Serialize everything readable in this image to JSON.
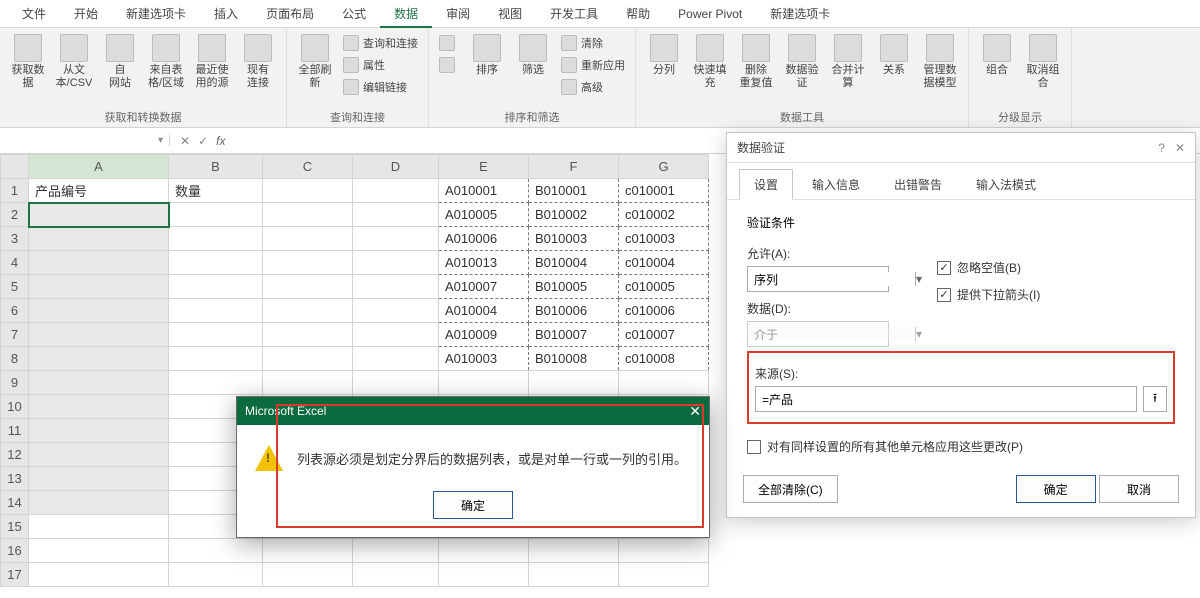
{
  "ribbon_tabs": [
    "文件",
    "开始",
    "新建选项卡",
    "插入",
    "页面布局",
    "公式",
    "数据",
    "审阅",
    "视图",
    "开发工具",
    "帮助",
    "Power Pivot",
    "新建选项卡"
  ],
  "active_tab_index": 6,
  "ribbon": {
    "g1": {
      "label": "获取和转换数据",
      "btns": [
        "获取数\n据",
        "从文\n本/CSV",
        "自\n网站",
        "来自表\n格/区域",
        "最近使\n用的源",
        "现有\n连接"
      ]
    },
    "g2": {
      "label": "查询和连接",
      "main": "全部刷\n新",
      "items": [
        "查询和连接",
        "属性",
        "编辑链接"
      ]
    },
    "g3": {
      "label": "排序和筛选",
      "sort_big": "排序",
      "filter_big": "筛选",
      "items": [
        "清除",
        "重新应用",
        "高级"
      ]
    },
    "g4": {
      "label": "数据工具",
      "btns": [
        "分列",
        "快速填充",
        "删除\n重复值",
        "数据验\n证",
        "合并计算",
        "关系",
        "管理数\n据模型"
      ]
    },
    "g5": {
      "label": "分级显示",
      "btns": [
        "组合",
        "取消组合"
      ]
    }
  },
  "name_box": "",
  "col_headers": [
    "A",
    "B",
    "C",
    "D",
    "E",
    "F",
    "G"
  ],
  "row_count": 17,
  "cells": {
    "A1": "产品编号",
    "B1": "数量",
    "E1": "A010001",
    "F1": "B010001",
    "G1": "c010001",
    "E2": "A010005",
    "F2": "B010002",
    "G2": "c010002",
    "E3": "A010006",
    "F3": "B010003",
    "G3": "c010003",
    "E4": "A010013",
    "F4": "B010004",
    "G4": "c010004",
    "E5": "A010007",
    "F5": "B010005",
    "G5": "c010005",
    "E6": "A010004",
    "F6": "B010006",
    "G6": "c010006",
    "E7": "A010009",
    "F7": "B010007",
    "G7": "c010007",
    "E8": "A010003",
    "F8": "B010008",
    "G8": "c010008"
  },
  "dv": {
    "title": "数据验证",
    "tabs": [
      "设置",
      "输入信息",
      "出错警告",
      "输入法模式"
    ],
    "section": "验证条件",
    "allow_label": "允许(A):",
    "allow_value": "序列",
    "ignore_blank": "忽略空值(B)",
    "dropdown": "提供下拉箭头(I)",
    "data_label": "数据(D):",
    "data_value": "介于",
    "source_label": "来源(S):",
    "source_value": "=产品",
    "apply_all": "对有同样设置的所有其他单元格应用这些更改(P)",
    "clear": "全部清除(C)",
    "ok": "确定",
    "cancel": "取消"
  },
  "err": {
    "title": "Microsoft Excel",
    "msg": "列表源必须是划定分界后的数据列表，或是对单一行或一列的引用。",
    "ok": "确定"
  }
}
